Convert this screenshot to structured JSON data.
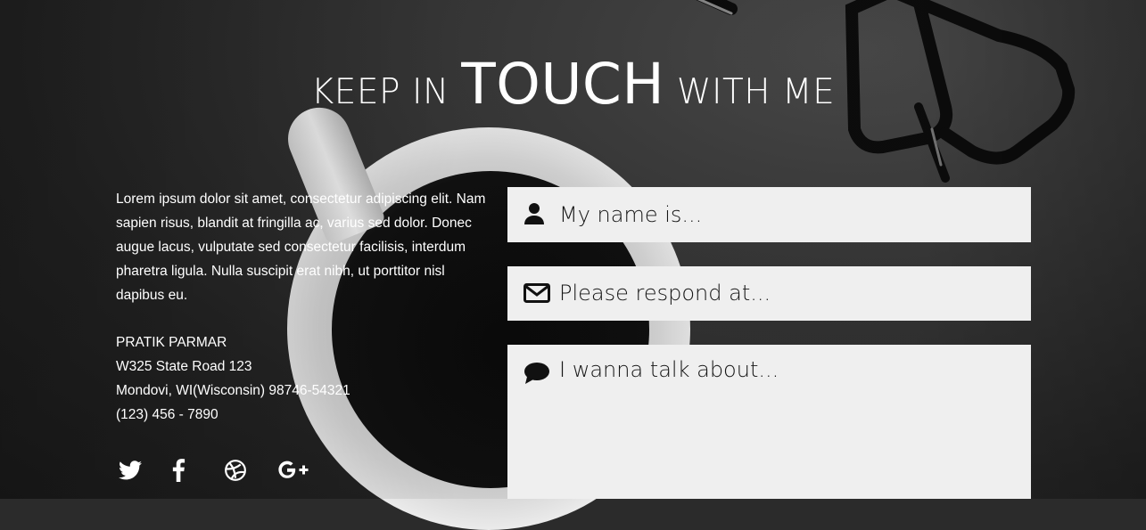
{
  "heading": {
    "pre": "KEEP IN",
    "emphasis": "TOUCH",
    "post": "WITH ME"
  },
  "intro": "Lorem ipsum dolor sit amet, consectetur adipiscing elit. Nam sapien risus, blandit at fringilla ac, varius sed dolor. Donec augue lacus, vulputate sed consectetur facilisis, interdum pharetra ligula. Nulla suscipit erat nibh, ut porttitor nisl dapibus eu.",
  "contact": {
    "name": "PRATIK PARMAR",
    "street": "W325 State Road 123",
    "city": "Mondovi, WI(Wisconsin) 98746-54321",
    "phone": "(123) 456 - 7890"
  },
  "socials": [
    {
      "icon": "twitter-icon"
    },
    {
      "icon": "facebook-icon"
    },
    {
      "icon": "dribbble-icon"
    },
    {
      "icon": "google-plus-icon"
    }
  ],
  "form": {
    "name_placeholder": "My name is...",
    "email_placeholder": "Please respond at...",
    "message_placeholder": "I wanna talk about...",
    "name_value": "",
    "email_value": "",
    "message_value": ""
  },
  "colors": {
    "field_bg": "#efefef",
    "text": "#ffffff",
    "field_text": "#111111"
  }
}
